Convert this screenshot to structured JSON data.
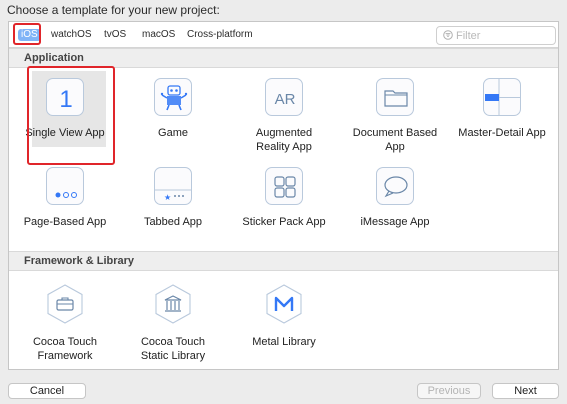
{
  "prompt": "Choose a template for your new project:",
  "tabs": [
    {
      "label": "iOS",
      "selected": true
    },
    {
      "label": "watchOS"
    },
    {
      "label": "tvOS"
    },
    {
      "label": "macOS"
    },
    {
      "label": "Cross-platform"
    }
  ],
  "filter": {
    "placeholder": "Filter",
    "icon": "filter-icon"
  },
  "sections": {
    "application": {
      "title": "Application",
      "items": [
        {
          "label": "Single View App",
          "icon": "single-view-icon",
          "selected": true
        },
        {
          "label": "Game",
          "icon": "game-icon"
        },
        {
          "label": "Augmented Reality App",
          "icon": "ar-icon"
        },
        {
          "label": "Document Based App",
          "icon": "folder-icon"
        },
        {
          "label": "Master-Detail App",
          "icon": "master-detail-icon"
        },
        {
          "label": "Page-Based App",
          "icon": "page-based-icon"
        },
        {
          "label": "Tabbed App",
          "icon": "tabbed-icon"
        },
        {
          "label": "Sticker Pack App",
          "icon": "sticker-pack-icon"
        },
        {
          "label": "iMessage App",
          "icon": "speech-bubble-icon"
        }
      ]
    },
    "framework": {
      "title": "Framework & Library",
      "items": [
        {
          "label": "Cocoa Touch Framework",
          "icon": "toolbox-icon"
        },
        {
          "label": "Cocoa Touch Static Library",
          "icon": "library-building-icon"
        },
        {
          "label": "Metal Library",
          "icon": "metal-icon"
        }
      ]
    }
  },
  "buttons": {
    "cancel": "Cancel",
    "previous": "Previous",
    "next": "Next"
  },
  "colors": {
    "accent": "#3478f6",
    "selection_outline": "#e0252a",
    "tab_selected": "#80b4f7"
  }
}
